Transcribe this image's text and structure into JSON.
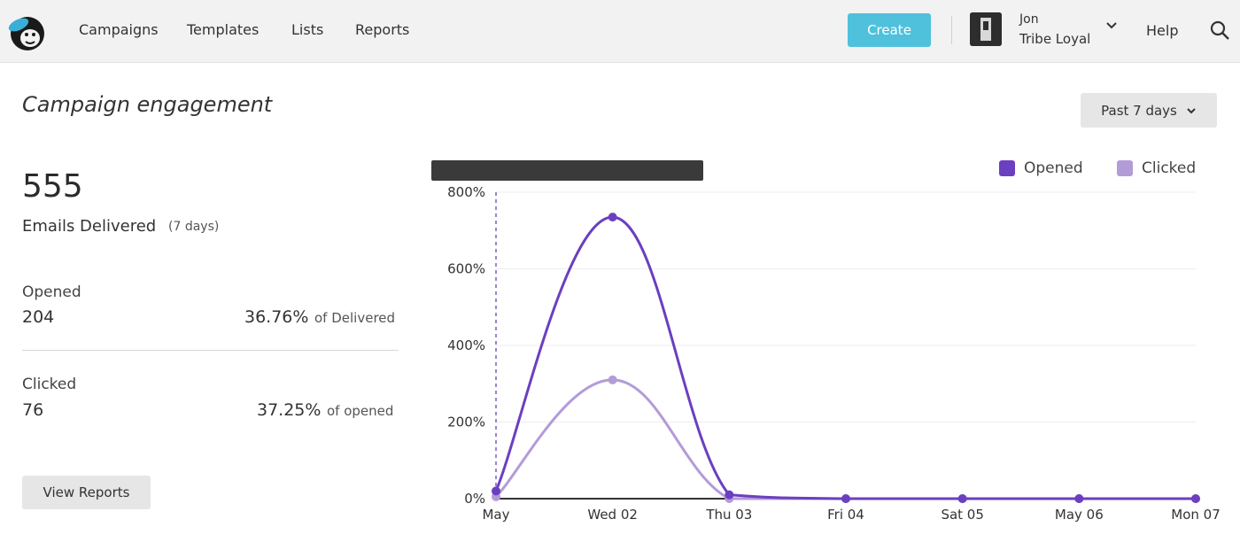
{
  "nav": {
    "items": [
      "Campaigns",
      "Templates",
      "Lists",
      "Reports"
    ],
    "create_label": "Create",
    "account_name": "Jon",
    "account_org": "Tribe Loyal",
    "help_label": "Help"
  },
  "page": {
    "title": "Campaign engagement",
    "range_label": "Past 7 days"
  },
  "summary": {
    "delivered_count": "555",
    "delivered_label": "Emails Delivered",
    "delivered_period": "(7 days)",
    "opened": {
      "label": "Opened",
      "value": "204",
      "percent": "36.76%",
      "of_label": "of Delivered"
    },
    "clicked": {
      "label": "Clicked",
      "value": "76",
      "percent": "37.25%",
      "of_label": "of opened"
    },
    "view_reports_label": "View Reports"
  },
  "colors": {
    "opened": "#6b3fc0",
    "clicked": "#b39bd8",
    "create": "#4fc1dc"
  },
  "chart_data": {
    "type": "line",
    "categories": [
      "May",
      "Wed 02",
      "Thu 03",
      "Fri 04",
      "Sat 05",
      "May 06",
      "Mon 07"
    ],
    "series": [
      {
        "name": "Opened",
        "values": [
          20,
          735,
          10,
          0,
          0,
          0,
          0
        ]
      },
      {
        "name": "Clicked",
        "values": [
          5,
          310,
          0,
          0,
          0,
          0,
          0
        ]
      }
    ],
    "yticks": [
      "0%",
      "200%",
      "400%",
      "600%",
      "800%"
    ],
    "ylim": [
      0,
      800
    ],
    "legend": "top-right",
    "grid": true
  }
}
